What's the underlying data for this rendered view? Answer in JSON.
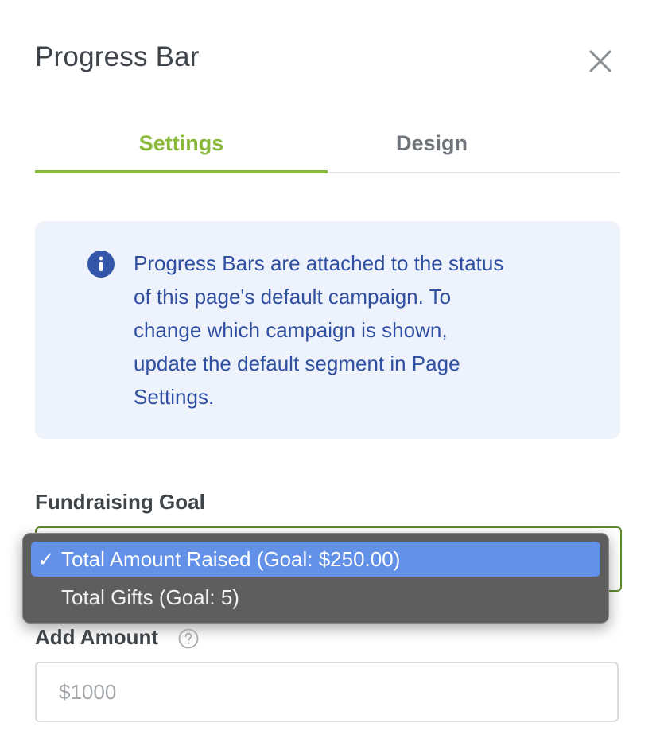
{
  "panel": {
    "title": "Progress Bar",
    "close_icon": "close-icon"
  },
  "tabs": [
    {
      "label": "Settings",
      "active": true
    },
    {
      "label": "Design",
      "active": false
    }
  ],
  "info": {
    "icon": "info-icon",
    "text": "Progress Bars are attached to the status of this page's default campaign. To change which campaign is shown, update the default segment in Page Settings."
  },
  "fundraising_goal": {
    "label": "Fundraising Goal",
    "options": [
      {
        "label": "Total Amount Raised (Goal: $250.00)",
        "selected": true
      },
      {
        "label": "Total Gifts (Goal: 5)",
        "selected": false
      }
    ],
    "check_mark": "✓"
  },
  "add_amount": {
    "label": "Add Amount",
    "help_icon": "help-circle-icon",
    "placeholder": "$1000",
    "value": ""
  },
  "colors": {
    "accent": "#8ab83b",
    "info_text": "#2f4fa0",
    "info_bg": "#eef2fb",
    "select_highlight": "#6391e8",
    "dropdown_bg": "#5e5e5e"
  }
}
